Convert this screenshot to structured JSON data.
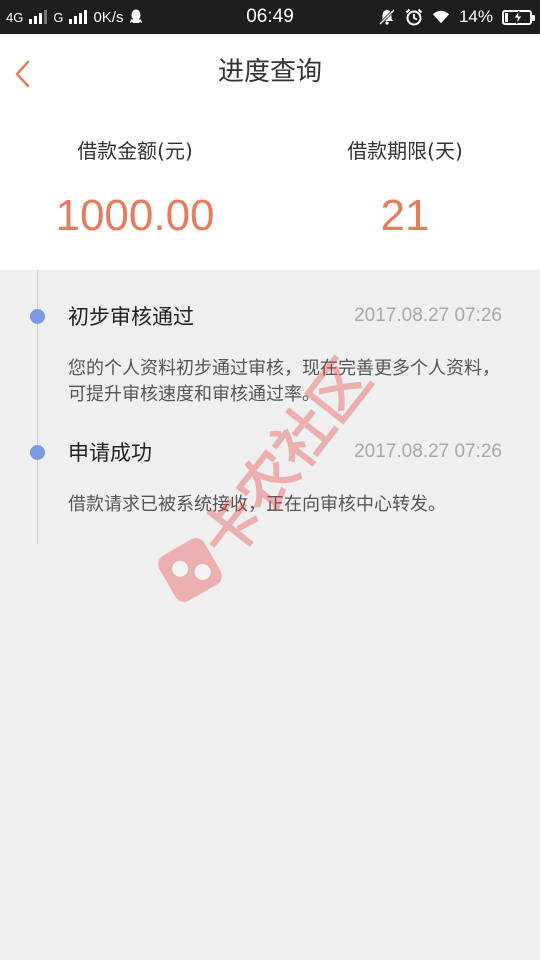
{
  "status_bar": {
    "network_1": "4G",
    "network_2": "G",
    "speed": "0K/s",
    "time": "06:49",
    "battery": "14%",
    "battery_level": 0.14
  },
  "header": {
    "title": "进度查询"
  },
  "summary": {
    "amount_label": "借款金额(元)",
    "amount_value": "1000.00",
    "term_label": "借款期限(天)",
    "term_value": "21"
  },
  "timeline": [
    {
      "title": "初步审核通过",
      "time": "2017.08.27 07:26",
      "desc": "您的个人资料初步通过审核，现在完善更多个人资料，可提升审核速度和审核通过率。"
    },
    {
      "title": "申请成功",
      "time": "2017.08.27 07:26",
      "desc": "借款请求已被系统接收，正在向审核中心转发。"
    }
  ],
  "watermark": {
    "text": "卡农社区"
  },
  "colors": {
    "accent": "#e77b5c",
    "timeline_dot": "#7a9be3",
    "status_bar": "#1e1e1e",
    "background": "#efefef"
  }
}
